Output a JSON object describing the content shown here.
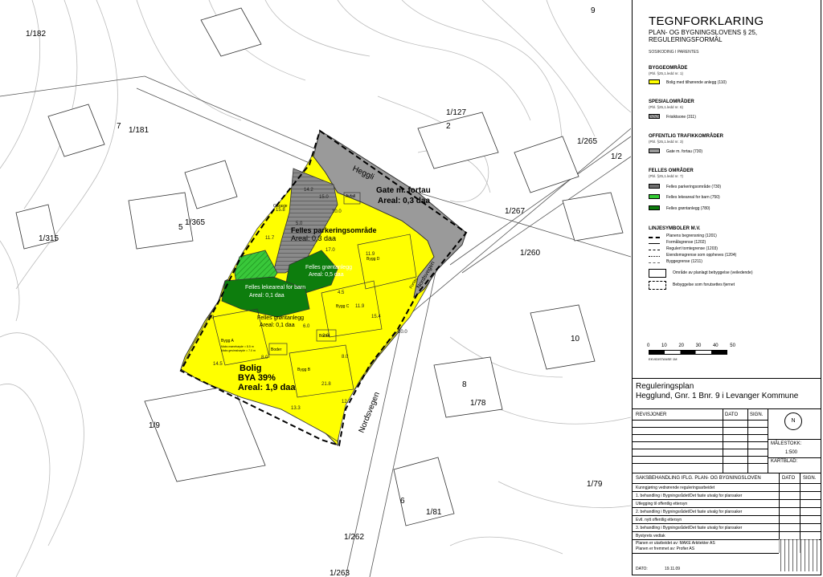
{
  "map": {
    "labels": {
      "plot_9": "9",
      "plot_1_182": "1/182",
      "plot_7": "7",
      "plot_1_181": "1/181",
      "plot_1_127": "1/127",
      "plot_2": "2",
      "plot_1_265": "1/265",
      "plot_1_2": "1/2",
      "plot_5": "5",
      "plot_1_365": "1/365",
      "plot_1_315": "1/315",
      "plot_1_267": "1/267",
      "plot_1_260": "1/260",
      "plot_10": "10",
      "plot_8": "8",
      "plot_1_78": "1/78",
      "plot_1_9": "1/9",
      "plot_1_79": "1/79",
      "plot_6": "6",
      "plot_1_81": "1/81",
      "plot_1_262": "1/262",
      "plot_1_263": "1/263",
      "road_heggli": "Heggli",
      "road_nordsvegen": "Nordsvegen",
      "road_nordsvegen2": "Nordsvegen"
    },
    "zones": {
      "gate_title": "Gate m. fortau",
      "gate_area": "Areal: 0,3 daa",
      "parking_title": "Felles parkeringsområde",
      "parking_area": "Areal: 0,3 daa",
      "green1_title": "Felles grøntanlegg",
      "green1_area": "Areal: 0,5 daa",
      "play_title": "Felles lekeareal for barn",
      "play_area": "Areal: 0,1 daa",
      "green2_title": "Felles grøntanlegg",
      "green2_area": "Areal: 0,1 daa",
      "bolig_title": "Bolig",
      "bolig_bya": "BYA 39%",
      "bolig_area": "Areal: 1,9 daa",
      "garasje": "Garasje",
      "avfall": "Avfall",
      "bygg_a": "Bygg A",
      "bygg_b": "Bygg B",
      "bygg_c": "Bygg C",
      "bygg_d": "Bygg D",
      "boder1": "Boder",
      "boder2": "Boder",
      "bygg_a_gesims": "Maks mønehøyde = 8.5 m",
      "bygg_a_mone": "Maks gesimshøyde = 7.0 m",
      "fortau_label": "Fortau",
      "dims": {
        "d1": "14.2",
        "d2": "15.8",
        "d3": "5.0",
        "d4": "11.7",
        "d5": "15.0",
        "d6": "10.0",
        "d7": "17.0",
        "d8": "11.9",
        "d9": "4.5",
        "d10": "11.9",
        "d11": "15.4",
        "d12": "4.0",
        "d13": "8.0",
        "d14": "6.0",
        "d15": "13.3",
        "d16": "8.0",
        "d17": "12.7",
        "d18": "14.5",
        "d19": "21.8",
        "d20": "2.0",
        "d21": "10.0"
      }
    }
  },
  "legend": {
    "title": "TEGNFORKLARING",
    "subtitle1": "PLAN- OG BYGNINGSLOVENS § 25,",
    "subtitle2": "REGULERINGSFORMÅL",
    "sosi": "SOSIKODING I PARENTES",
    "sections": [
      {
        "title": "BYGGEOMRÅDE",
        "ref": "(Pbl. §25,1.ledd nr. 1)",
        "items": [
          {
            "label": "Bolig med tilhørende anlegg (110)",
            "color": "#ffff00"
          }
        ]
      },
      {
        "title": "SPESIALOMRÅDER",
        "ref": "(Pbl. §25,1.ledd nr. 6)",
        "items": [
          {
            "label": "Frisiktsone (311)",
            "color": "#8c8c8c"
          }
        ]
      },
      {
        "title": "OFFENTLIG TRAFIKKOMRÅDER",
        "ref": "(Pbl. §25,1.ledd nr. 3)",
        "items": [
          {
            "label": "Gate m. fortau (730)",
            "color": "#9a9a9a"
          }
        ]
      },
      {
        "title": "FELLES OMRÅDER",
        "ref": "(Pbl. §25,1.ledd nr. 7)",
        "items": [
          {
            "label": "Felles parkeringsområde (730)",
            "color": "#6e6e6e"
          },
          {
            "label": "Felles lekeareal for barn (750)",
            "color": "#33cc33"
          },
          {
            "label": "Felles grøntanlegg (780)",
            "color": "#0c7a0c"
          }
        ]
      }
    ],
    "lines_title": "LINJESYMBOLER M.V.",
    "lines": [
      {
        "label": "Planens begrensning (1201)",
        "style": "thickdash"
      },
      {
        "label": "Formålsgrense (1202)",
        "style": "thin"
      },
      {
        "label": "Regulert tomtegrense (1203)",
        "style": "dash"
      },
      {
        "label": "Eiendomsgrense som oppheves (1204)",
        "style": "dashdot"
      },
      {
        "label": "Byggegrense (1211)",
        "style": "longdash"
      }
    ],
    "boxes": [
      {
        "label": "Område av planlagt bebyggelse (veiledende)"
      },
      {
        "label": "Bebyggelse som forutsettes fjernet"
      }
    ],
    "scale_ticks": [
      "0",
      "10",
      "20",
      "30",
      "40",
      "50"
    ],
    "scale_unit": "EKVIDISTANSE 1M",
    "plan_title1": "Reguleringsplan",
    "plan_title2": "Hegglund, Gnr. 1 Bnr. 9 i Levanger Kommune",
    "revisjoner": "REVISJONER",
    "dato": "DATO",
    "sign": "SIGN.",
    "north": "N",
    "malestokk_label": "MÅLESTOKK:",
    "malestokk_value": "1:500",
    "kartblad_label": "KARTBLAD:",
    "saksbehandling": "SAKSBEHANDLING IFLG. PLAN- OG BYGNINGSLOVEN",
    "dato2": "DATO",
    "sign2": "SIGN.",
    "steps": [
      "Kunngjøring vedrørende reguleringsarbeidet",
      "1. behandling i Bygningsrådet/Det faste utvalg for plansaker",
      "Utlegging til offentlig ettersyn",
      "2. behandling i Bygningsrådet/Det faste utvalg for plansaker",
      "Evtl. nytt offentlig ettersyn",
      "3. behandling i Bygningsrådet/Det faste utvalg for plansaker",
      "Bystyrets vedtak"
    ],
    "utarbeidet": "Planen er utarbeidet av: MAKE Arkitekter AS",
    "fremmet": "Planen er fremmet av: Profier AS",
    "dato_label": "DATO:",
    "dato_value": "19.11.09"
  }
}
